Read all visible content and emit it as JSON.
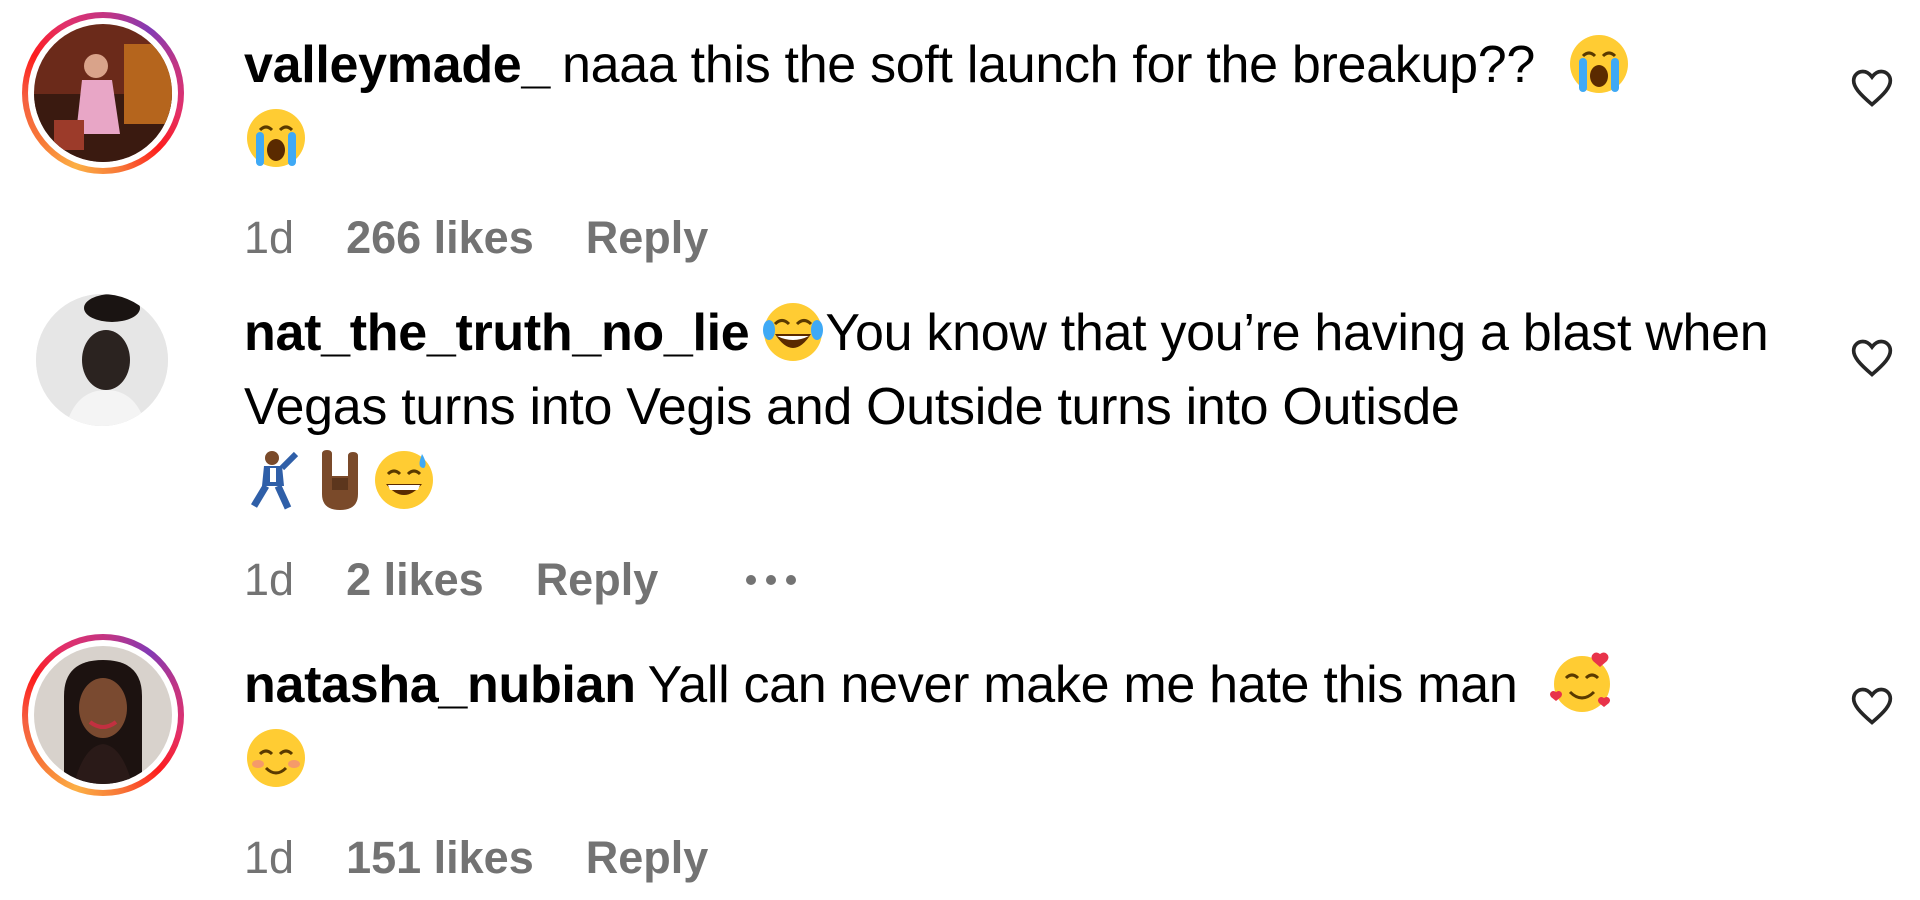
{
  "comments": [
    {
      "username": "valleymade_",
      "text": "naaa this the soft launch for the breakup??",
      "emojis": [
        "loudly-crying-face",
        "loudly-crying-face"
      ],
      "time": "1d",
      "likes": "266 likes",
      "reply_label": "Reply",
      "has_story_ring": true
    },
    {
      "username": "nat_the_truth_no_lie",
      "text": "You know that you’re having a blast when Vegas turns into Vegis and Outside turns into Outisde",
      "emojis": [
        "face-with-tears-of-joy",
        "man-dancing",
        "sign-of-the-horns",
        "grinning-face-with-sweat"
      ],
      "time": "1d",
      "likes": "2 likes",
      "reply_label": "Reply",
      "has_story_ring": false
    },
    {
      "username": "natasha_nubian",
      "text": "Yall can never make me hate this man",
      "emojis": [
        "smiling-face-with-hearts",
        "smiling-face-with-smiling-eyes"
      ],
      "time": "1d",
      "likes": "151 likes",
      "reply_label": "Reply",
      "has_story_ring": true
    }
  ],
  "colors": {
    "meta_text": "#737373",
    "emoji_yellow": "#ffcc33"
  }
}
